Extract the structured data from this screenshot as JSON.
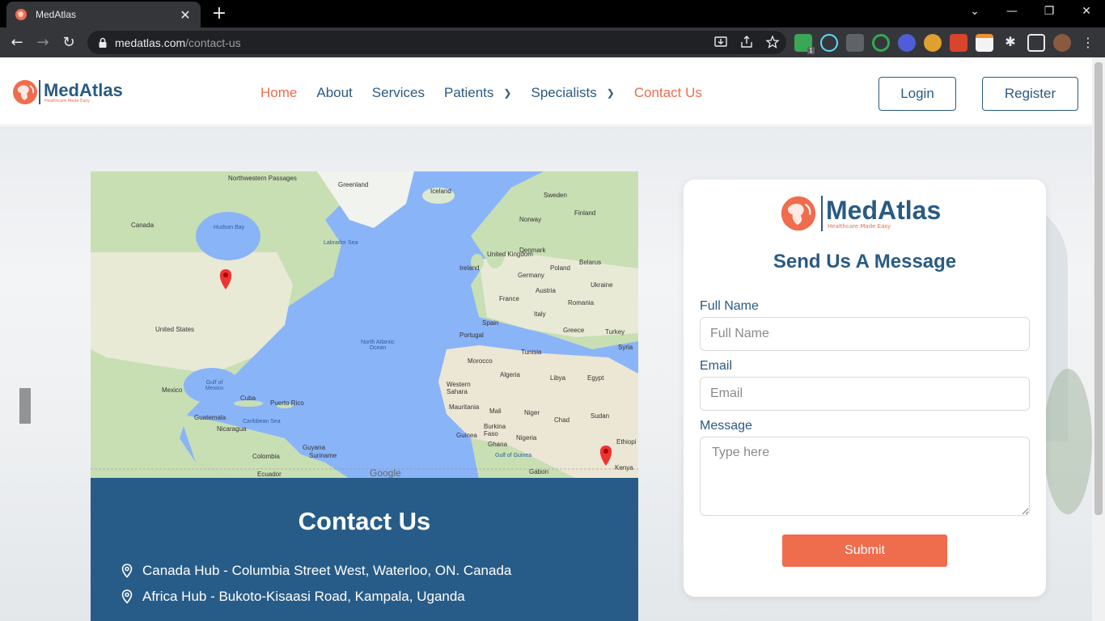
{
  "browser": {
    "tab_title": "MedAtlas",
    "url_host": "medatlas.com",
    "url_path": "/contact-us",
    "ext_badge": "1"
  },
  "header": {
    "logo_text": "MedAtlas",
    "logo_tagline": "Healthcare Made Easy",
    "nav": [
      {
        "label": "Home",
        "active": true
      },
      {
        "label": "About"
      },
      {
        "label": "Services"
      },
      {
        "label": "Patients",
        "dropdown": true
      },
      {
        "label": "Specialists",
        "dropdown": true
      },
      {
        "label": "Contact Us",
        "active": true
      }
    ],
    "login_label": "Login",
    "register_label": "Register"
  },
  "map": {
    "labels": {
      "greenland": "Greenland",
      "iceland": "Iceland",
      "nw_passages": "Northwestern Passages",
      "sweden": "Sweden",
      "finland": "Finland",
      "norway": "Norway",
      "canada": "Canada",
      "hudson_bay": "Hudson Bay",
      "labrador_sea": "Labrador Sea",
      "ireland": "Ireland",
      "uk": "United Kingdom",
      "denmark": "Denmark",
      "belarus": "Belarus",
      "poland": "Poland",
      "germany": "Germany",
      "ukraine": "Ukraine",
      "austria": "Austria",
      "france": "France",
      "romania": "Romania",
      "italy": "Italy",
      "spain": "Spain",
      "portugal": "Portugal",
      "greece": "Greece",
      "turkey": "Turkey",
      "united_states": "United States",
      "north_atlantic": "North Atlantic Ocean",
      "tunisia": "Tunisia",
      "syria": "Syria",
      "morocco": "Morocco",
      "algeria": "Algeria",
      "libya": "Libya",
      "egypt": "Egypt",
      "gulf_mexico": "Gulf of Mexico",
      "mexico": "Mexico",
      "cuba": "Cuba",
      "puerto_rico": "Puerto Rico",
      "western_sahara": "Western Sahara",
      "mauritania": "Mauritania",
      "mali": "Mali",
      "niger": "Niger",
      "chad": "Chad",
      "sudan": "Sudan",
      "guatemala": "Guatemala",
      "caribbean": "Caribbean Sea",
      "nicaragua": "Nicaragua",
      "burkina": "Burkina Faso",
      "guinea": "Guinea",
      "nigeria": "Nigeria",
      "ghana": "Ghana",
      "ethiopia": "Ethiopi",
      "guyana": "Guyana",
      "suriname": "Suriname",
      "colombia": "Colombia",
      "gulf_guinea": "Gulf of Guinea",
      "ecuador": "Ecuador",
      "gabon": "Gabon",
      "kenya": "Kenya",
      "google": "Google"
    }
  },
  "contact": {
    "title": "Contact Us",
    "lines": [
      "Canada Hub - Columbia Street West, Waterloo, ON. Canada",
      "Africa Hub - Bukoto-Kisaasi Road, Kampala, Uganda"
    ]
  },
  "form": {
    "logo_text": "MedAtlas",
    "logo_tagline": "Healthcare Made Easy",
    "title": "Send Us A Message",
    "full_name_label": "Full Name",
    "full_name_placeholder": "Full Name",
    "email_label": "Email",
    "email_placeholder": "Email",
    "message_label": "Message",
    "message_placeholder": "Type here",
    "submit_label": "Submit"
  },
  "colors": {
    "brand_blue": "#2a5a83",
    "brand_orange": "#ef6c4d",
    "card_blue": "#275c88"
  }
}
